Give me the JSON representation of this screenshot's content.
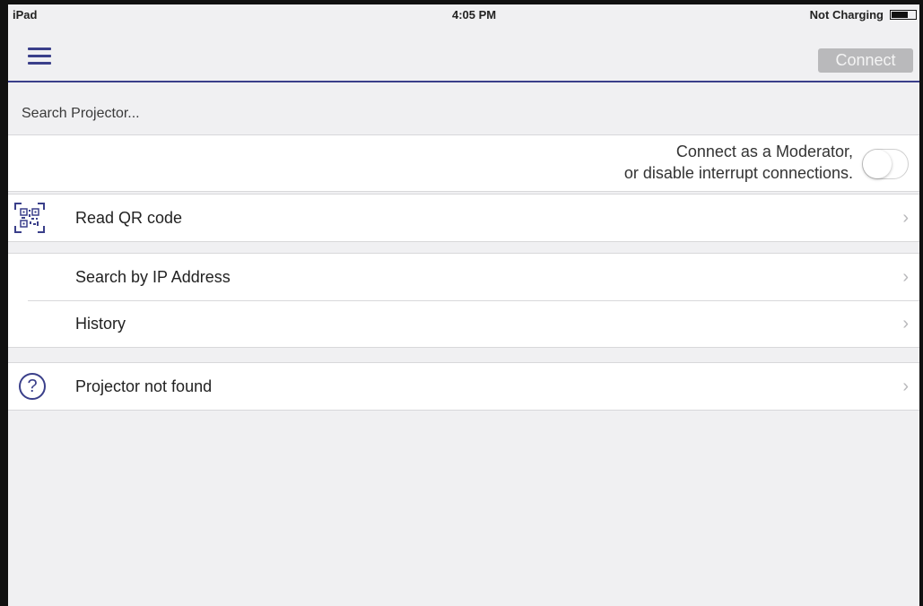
{
  "status_bar": {
    "device": "iPad",
    "time": "4:05 PM",
    "charge_status": "Not Charging",
    "battery_level": 0.7
  },
  "navbar": {
    "menu_icon": "hamburger-menu-icon",
    "connect_label": "Connect",
    "connect_enabled": false,
    "accent_color": "#3a3f8a"
  },
  "search": {
    "placeholder": "Search Projector..."
  },
  "moderator": {
    "line1": "Connect as a Moderator,",
    "line2": "or disable interrupt connections.",
    "toggle_on": false
  },
  "menu": {
    "read_qr": {
      "label": "Read QR code",
      "icon": "qr-code-icon"
    },
    "search_ip": {
      "label": "Search by IP Address"
    },
    "history": {
      "label": "History"
    },
    "not_found": {
      "label": "Projector not found",
      "icon": "help-circle-icon",
      "glyph": "?"
    },
    "chevron": "›"
  }
}
